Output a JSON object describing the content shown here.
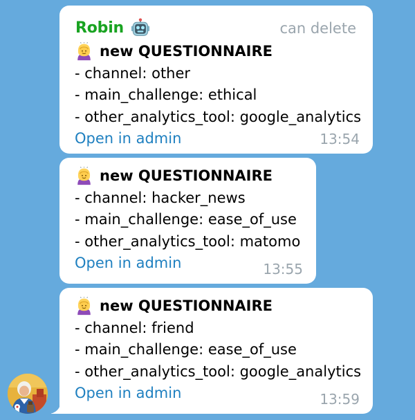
{
  "colors": {
    "background": "#65aadd",
    "bubble": "#ffffff",
    "sender_name": "#19a321",
    "link": "#1f80c0",
    "meta_text": "#9aa5ad"
  },
  "sender": {
    "name": "Robin",
    "icon": "robot-icon",
    "status": "can delete"
  },
  "messages": [
    {
      "icon": "person-with-headscarf-icon",
      "title": "new QUESTIONNAIRE",
      "lines": [
        "- channel: other",
        "- main_challenge: ethical",
        "- other_analytics_tool: google_analytics"
      ],
      "link": "Open in admin",
      "time": "13:54"
    },
    {
      "icon": "person-with-headscarf-icon",
      "title": "new QUESTIONNAIRE",
      "lines": [
        "- channel: hacker_news",
        "- main_challenge: ease_of_use",
        "- other_analytics_tool: matomo"
      ],
      "link": "Open in admin",
      "time": "13:55"
    },
    {
      "icon": "person-with-headscarf-icon",
      "title": "new QUESTIONNAIRE",
      "lines": [
        "- channel: friend",
        "- main_challenge: ease_of_use",
        "- other_analytics_tool: google_analytics"
      ],
      "link": "Open in admin",
      "time": "13:59"
    }
  ],
  "avatar": {
    "icon": "user-avatar"
  }
}
